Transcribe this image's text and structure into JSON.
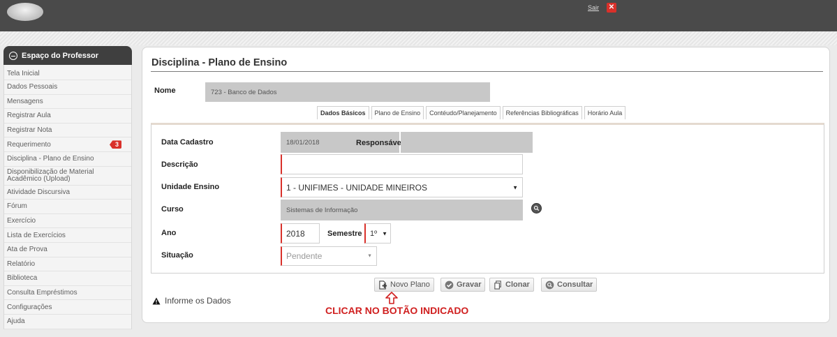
{
  "header": {
    "user_link": "Sair",
    "logout_icon": "close-icon"
  },
  "sidebar": {
    "title": "Espaço do Professor",
    "items": [
      {
        "label": "Tela Inicial"
      },
      {
        "label": "Dados Pessoais"
      },
      {
        "label": "Mensagens"
      },
      {
        "label": "Registrar Aula"
      },
      {
        "label": "Registrar Nota"
      },
      {
        "label": "Requerimento",
        "badge": "3"
      },
      {
        "label": "Disciplina - Plano de Ensino"
      },
      {
        "label": "Disponibilização de Material Acadêmico (Upload)"
      },
      {
        "label": "Atividade Discursiva"
      },
      {
        "label": "Fórum"
      },
      {
        "label": "Exercício"
      },
      {
        "label": "Lista de Exercícios"
      },
      {
        "label": "Ata de Prova"
      },
      {
        "label": "Relatório"
      },
      {
        "label": "Biblioteca"
      },
      {
        "label": "Consulta Empréstimos"
      },
      {
        "label": "Configurações"
      },
      {
        "label": "Ajuda"
      }
    ]
  },
  "main": {
    "title": "Disciplina - Plano de Ensino",
    "nome_label": "Nome",
    "nome_value": "723 - Banco de Dados",
    "tabs": [
      {
        "label": "Dados Básicos",
        "active": true
      },
      {
        "label": "Plano de Ensino"
      },
      {
        "label": "Contéudo/Planejamento"
      },
      {
        "label": "Referências Bibliográficas"
      },
      {
        "label": "Horário Aula"
      }
    ],
    "form": {
      "data_cadastro_label": "Data Cadastro",
      "data_cadastro_value": "18/01/2018",
      "responsavel_label": "Responsável",
      "responsavel_value": "",
      "descricao_label": "Descrição",
      "descricao_value": "",
      "unidade_label": "Unidade Ensino",
      "unidade_value": "1 - UNIFIMES - UNIDADE MINEIROS",
      "curso_label": "Curso",
      "curso_value": "Sistemas de Informação",
      "ano_label": "Ano",
      "ano_value": "2018",
      "semestre_label": "Semestre",
      "semestre_value": "1º",
      "situacao_label": "Situação",
      "situacao_value": "Pendente"
    },
    "buttons": {
      "novo_plano": "Novo Plano",
      "gravar": "Gravar",
      "clonar": "Clonar",
      "consultar": "Consultar"
    },
    "info_text": "Informe os Dados",
    "hint": "CLICAR NO BOTÃO INDICADO"
  },
  "colors": {
    "accent_red": "#d9302a",
    "header_bg": "#4a4a4a",
    "hint_red": "#d02020"
  }
}
